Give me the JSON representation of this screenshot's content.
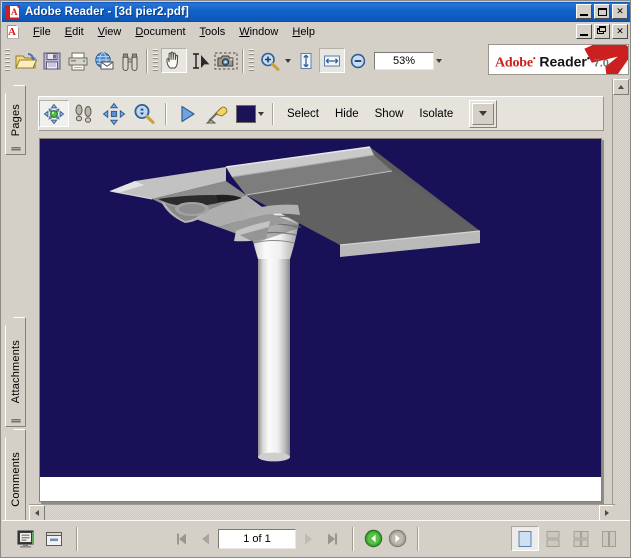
{
  "window": {
    "app_name": "Adobe Reader",
    "document_name": "3d pier2.pdf",
    "title": "Adobe Reader - [3d pier2.pdf]",
    "app_icon": "adobe-reader-icon",
    "controls": {
      "minimize": "_",
      "maximize": "□",
      "close": "✕"
    },
    "mdi_controls": {
      "minimize": "_",
      "restore": "❐",
      "close": "✕"
    }
  },
  "menubar": {
    "icon": "adobe-document-icon",
    "items": [
      {
        "label": "File",
        "accel": "F"
      },
      {
        "label": "Edit",
        "accel": "E"
      },
      {
        "label": "View",
        "accel": "V"
      },
      {
        "label": "Document",
        "accel": "D"
      },
      {
        "label": "Tools",
        "accel": "T"
      },
      {
        "label": "Window",
        "accel": "W"
      },
      {
        "label": "Help",
        "accel": "H"
      }
    ]
  },
  "toolbar": {
    "groups": [
      {
        "buttons": [
          {
            "name": "open-file-button",
            "icon": "open-folder-icon",
            "selected": false
          },
          {
            "name": "save-file-button",
            "icon": "floppy-disk-icon",
            "selected": false
          },
          {
            "name": "print-button",
            "icon": "printer-icon",
            "selected": false
          },
          {
            "name": "email-button",
            "icon": "email-globe-icon",
            "selected": false
          },
          {
            "name": "search-button",
            "icon": "binoculars-icon",
            "selected": false
          }
        ]
      },
      {
        "buttons": [
          {
            "name": "hand-tool-button",
            "icon": "hand-icon",
            "selected": true
          },
          {
            "name": "select-text-button",
            "icon": "text-select-icon",
            "selected": false
          },
          {
            "name": "snapshot-button",
            "icon": "camera-icon",
            "selected": false
          }
        ]
      },
      {
        "buttons": [
          {
            "name": "zoom-in-button",
            "icon": "magnifier-plus-icon",
            "selected": false
          }
        ]
      }
    ],
    "zoom_tools": {
      "actual_size_icon": "fit-height-icon",
      "fit_width_icon": "fit-width-icon",
      "zoom_out_icon": "magnifier-minus-icon",
      "zoom_value": "53%",
      "zoom_dropdown_icon": "chevron-down-icon"
    },
    "branding": {
      "adobe": "Adobe",
      "reader": "Reader",
      "version": "7.0",
      "trademark": "•",
      "logo_icon": "adobe-swoosh-logo"
    }
  },
  "sidebar": {
    "tabs": [
      {
        "label": "Pages",
        "name": "sidebar-tab-pages",
        "active": true
      },
      {
        "label": "Attachments",
        "name": "sidebar-tab-attachments",
        "active": false
      },
      {
        "label": "Comments",
        "name": "sidebar-tab-comments",
        "active": false
      }
    ]
  },
  "toolbar_3d": {
    "tools": [
      {
        "name": "rotate-tool-button",
        "icon": "rotate-3d-icon",
        "selected": true
      },
      {
        "name": "walk-tool-button",
        "icon": "footsteps-icon",
        "selected": false
      },
      {
        "name": "pan-tool-button",
        "icon": "pan-arrows-icon",
        "selected": false
      },
      {
        "name": "zoom-tool-button",
        "icon": "magnifier-3d-icon",
        "selected": false
      }
    ],
    "playback": [
      {
        "name": "play-animation-button",
        "icon": "play-triangle-icon",
        "selected": false
      },
      {
        "name": "lighting-button",
        "icon": "desk-lamp-icon",
        "selected": false
      }
    ],
    "background_swatch": {
      "name": "background-color-swatch",
      "color": "#1c1258",
      "dropdown_icon": "chevron-down-icon"
    },
    "actions": [
      {
        "label": "Select",
        "name": "select-button"
      },
      {
        "label": "Hide",
        "name": "hide-button"
      },
      {
        "label": "Show",
        "name": "show-button"
      },
      {
        "label": "Isolate",
        "name": "isolate-button"
      }
    ],
    "options_dropdown_icon": "chevron-down-icon"
  },
  "viewport": {
    "background_color": "#191157",
    "model_name": "3d-bridge-pier-model",
    "description": "Shaded 3D CAD model of a bridge pier: a tapered cylindrical column with a flared capital supporting a wide cantilevered deck cap beam",
    "page_background": "#ffffff"
  },
  "statusbar": {
    "left_buttons": [
      {
        "name": "page-display-button",
        "icon": "monitor-icon"
      },
      {
        "name": "toggle-sidebar-button",
        "icon": "sidebar-panel-icon"
      }
    ],
    "navigation": {
      "first_page_icon": "first-page-icon",
      "prev_page_icon": "previous-page-icon",
      "page_value": "1 of 1",
      "next_page_icon": "next-page-icon",
      "last_page_icon": "last-page-icon",
      "back_icon": "green-back-arrow-icon",
      "forward_icon": "gray-forward-arrow-icon"
    },
    "layout_buttons": [
      {
        "name": "single-page-layout-button",
        "icon": "single-page-icon",
        "selected": true
      },
      {
        "name": "continuous-layout-button",
        "icon": "continuous-pages-icon",
        "selected": false
      },
      {
        "name": "continuous-facing-layout-button",
        "icon": "continuous-facing-icon",
        "selected": false
      },
      {
        "name": "facing-layout-button",
        "icon": "facing-pages-icon",
        "selected": false
      }
    ]
  },
  "scrollbars": {
    "vertical": {
      "up_icon": "scroll-up-icon",
      "down_icon": "scroll-down-icon"
    },
    "horizontal": {
      "left_icon": "scroll-left-icon",
      "right_icon": "scroll-right-icon"
    }
  }
}
